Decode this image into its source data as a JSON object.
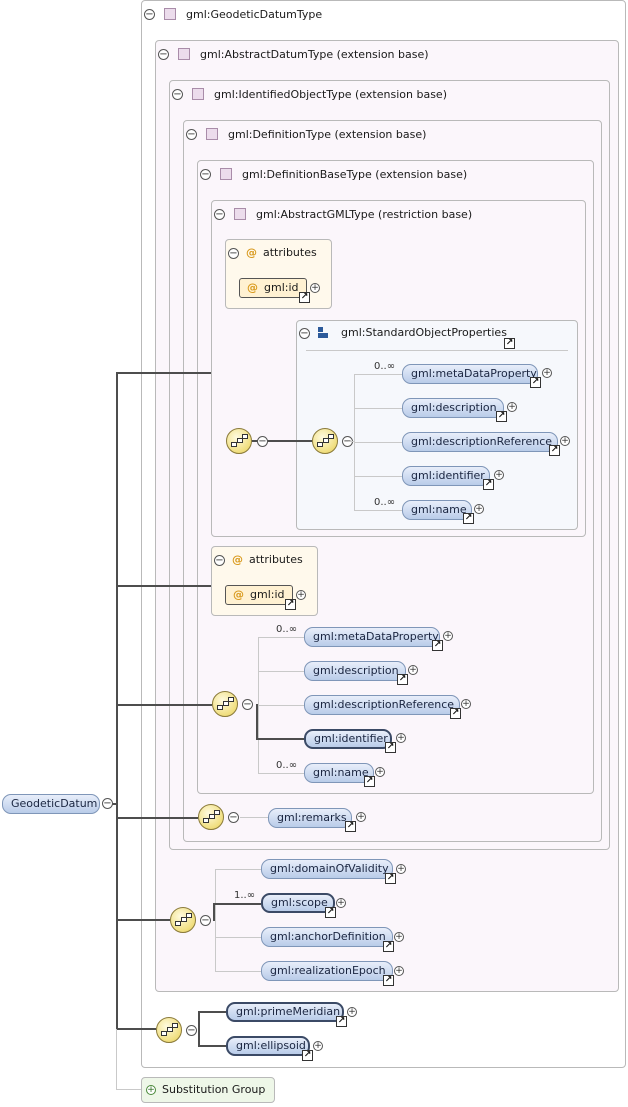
{
  "root": {
    "name": "GeodeticDatum"
  },
  "types": {
    "geodetic": "gml:GeodeticDatumType",
    "abstract_datum": "gml:AbstractDatumType (extension base)",
    "identified": "gml:IdentifiedObjectType (extension base)",
    "definition": "gml:DefinitionType (extension base)",
    "definition_base": "gml:DefinitionBaseType (extension base)",
    "abstract_gml": "gml:AbstractGMLType (restriction base)"
  },
  "attributes": {
    "label": "attributes",
    "inner_id": "gml:id",
    "outer_id": "gml:id"
  },
  "std_group": {
    "name": "gml:StandardObjectProperties",
    "items": [
      {
        "name": "gml:metaDataProperty",
        "card": "0..∞"
      },
      {
        "name": "gml:description",
        "card": ""
      },
      {
        "name": "gml:descriptionReference",
        "card": ""
      },
      {
        "name": "gml:identifier",
        "card": ""
      },
      {
        "name": "gml:name",
        "card": "0..∞"
      }
    ]
  },
  "def_base_seq": [
    {
      "name": "gml:metaDataProperty",
      "card": "0..∞"
    },
    {
      "name": "gml:description",
      "card": ""
    },
    {
      "name": "gml:descriptionReference",
      "card": ""
    },
    {
      "name": "gml:identifier",
      "card": ""
    },
    {
      "name": "gml:name",
      "card": "0..∞"
    }
  ],
  "remarks": "gml:remarks",
  "abstract_datum_seq": [
    {
      "name": "gml:domainOfValidity",
      "card": ""
    },
    {
      "name": "gml:scope",
      "card": "1..∞"
    },
    {
      "name": "gml:anchorDefinition",
      "card": ""
    },
    {
      "name": "gml:realizationEpoch",
      "card": ""
    }
  ],
  "geodetic_seq": [
    {
      "name": "gml:primeMeridian"
    },
    {
      "name": "gml:ellipsoid"
    }
  ],
  "substitution": "Substitution Group",
  "glyphs": {
    "minus": "−",
    "plus": "+",
    "link": "↗",
    "at": "@"
  }
}
